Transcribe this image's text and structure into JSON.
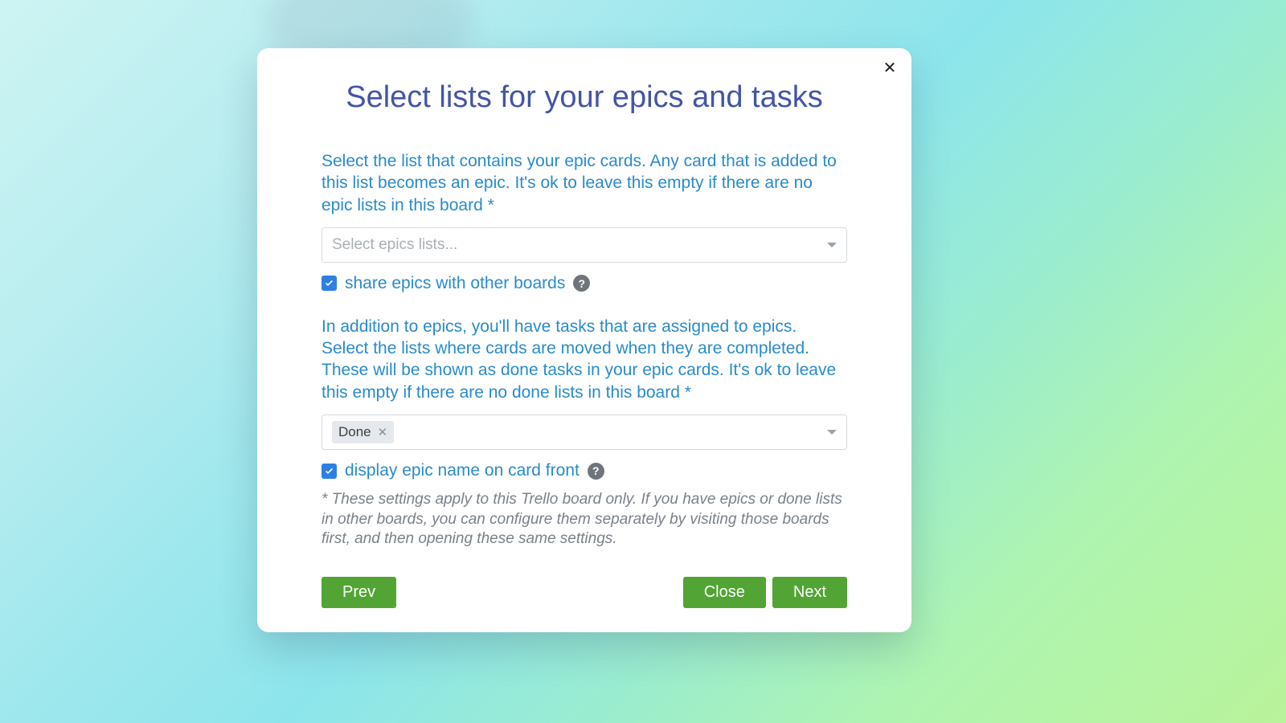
{
  "modal": {
    "title": "Select lists for your epics and tasks",
    "epicSection": {
      "label": "Select the list that contains your epic cards. Any card that is added to this list becomes an epic. It's ok to leave this empty if there are no epic lists in this board *",
      "placeholder": "Select epics lists...",
      "shareCheckbox": {
        "checked": true,
        "label": "share epics with other boards"
      }
    },
    "doneSection": {
      "label": "In addition to epics, you'll have tasks that are assigned to epics. Select the lists where cards are moved when they are completed. These will be shown as done tasks in your epic cards. It's ok to leave this empty if there are no done lists in this board *",
      "selectedTag": "Done",
      "displayNameCheckbox": {
        "checked": true,
        "label": "display epic name on card front"
      }
    },
    "footnote": "* These settings apply to this Trello board only. If you have epics or done lists in other boards, you can configure them separately by visiting those boards first, and then opening these same settings.",
    "buttons": {
      "prev": "Prev",
      "close": "Close",
      "next": "Next"
    }
  }
}
